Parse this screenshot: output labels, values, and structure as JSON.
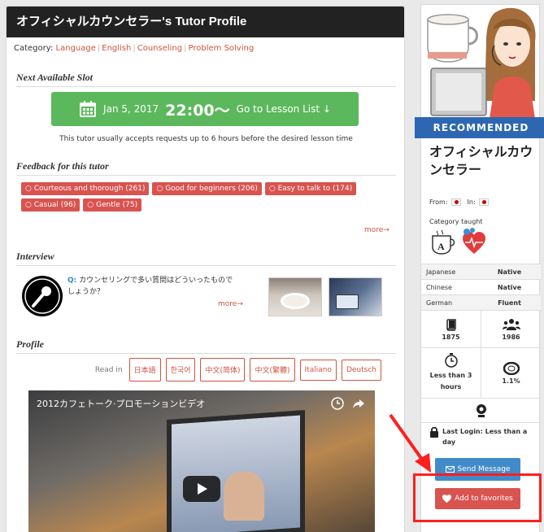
{
  "header": {
    "title": "オフィシャルカウンセラー's Tutor Profile"
  },
  "category": {
    "label": "Category:",
    "items": [
      "Language",
      "English",
      "Counseling",
      "Problem Solving"
    ]
  },
  "next_slot": {
    "section_title": "Next Available Slot",
    "date": "Jan 5, 2017",
    "time": "22:00～",
    "go_label": "Go to Lesson List ↓",
    "note": "This tutor usually accepts requests up to 6 hours before the desired lesson time"
  },
  "feedback": {
    "section_title": "Feedback for this tutor",
    "tags": [
      "Courteous and thorough (261)",
      "Good for beginners (206)",
      "Easy to talk to (174)",
      "Casual (96)",
      "Gentle (75)"
    ],
    "more": "more→"
  },
  "interview": {
    "section_title": "Interview",
    "q_prefix": "Q:",
    "question": "カウンセリングで多い質問はどういったものでしょうか？",
    "more": "more→"
  },
  "profile": {
    "section_title": "Profile",
    "read_in": "Read in",
    "languages": [
      "日本語",
      "한국어",
      "中文(简体)",
      "中文(繁體)",
      "Italiano",
      "Deutsch"
    ],
    "video_title": "2012カフェトーク·プロモーションビデオ"
  },
  "sidebar": {
    "ribbon": "RECOMMENDED",
    "tutor_name": "オフィシャルカウンセラー",
    "from_label": "From:",
    "in_label": "In:",
    "category_taught": "Category taught",
    "languages": [
      {
        "name": "Japanese",
        "level": "Native"
      },
      {
        "name": "Chinese",
        "level": "Native"
      },
      {
        "name": "German",
        "level": "Fluent"
      }
    ],
    "stats": {
      "lessons": "1875",
      "students": "1986",
      "response": "Less than 3 hours",
      "rate": "1.1%"
    },
    "last_login": "Last Login: Less than a day",
    "send_message": "Send Message",
    "add_favorites": "Add to favorites"
  },
  "colors": {
    "accent_red": "#d9534f",
    "green": "#5cb85c",
    "blue": "#428bca",
    "ribbon": "#2d67b2",
    "highlight": "#ff1f1f"
  }
}
